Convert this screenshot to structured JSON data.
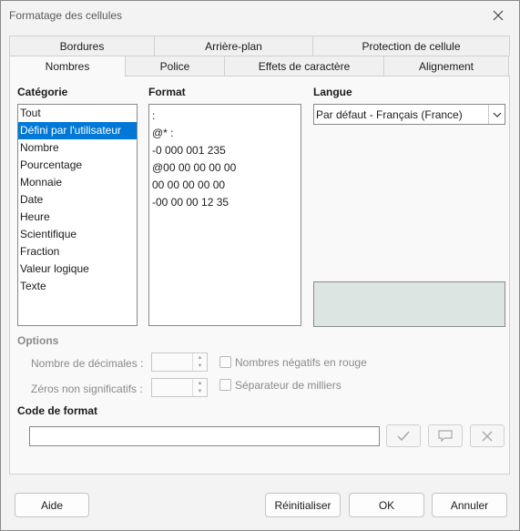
{
  "window": {
    "title": "Formatage des cellules"
  },
  "tabs_row1": [
    "Bordures",
    "Arrière-plan",
    "Protection de cellule"
  ],
  "tabs_row2": [
    "Nombres",
    "Police",
    "Effets de caractère",
    "Alignement"
  ],
  "active_tab": "Nombres",
  "category": {
    "label": "Catégorie",
    "items": [
      "Tout",
      "Défini par l'utilisateur",
      "Nombre",
      "Pourcentage",
      "Monnaie",
      "Date",
      "Heure",
      "Scientifique",
      "Fraction",
      "Valeur logique",
      "Texte"
    ],
    "selected": "Défini par l'utilisateur"
  },
  "format": {
    "label": "Format",
    "items": [
      ":",
      "@* :",
      "-0 000 001 235",
      "@00 00 00 00 00",
      "00 00 00 00 00",
      "-00 00 00 12 35"
    ]
  },
  "language": {
    "label": "Langue",
    "value": "Par défaut - Français (France)"
  },
  "options": {
    "label": "Options",
    "decimals_label": "Nombre de décimales :",
    "leading_zeros_label": "Zéros non significatifs :",
    "negative_red_label": "Nombres négatifs en rouge",
    "thousands_sep_label": "Séparateur de milliers"
  },
  "format_code": {
    "label": "Code de format",
    "value": ""
  },
  "buttons": {
    "help": "Aide",
    "reset": "Réinitialiser",
    "ok": "OK",
    "cancel": "Annuler"
  },
  "icons": {
    "close": "close-icon",
    "check": "check-icon",
    "comment": "comment-icon",
    "delete": "delete-icon"
  },
  "colors": {
    "selection": "#0078d7",
    "preview_bg": "#dde5e2"
  }
}
